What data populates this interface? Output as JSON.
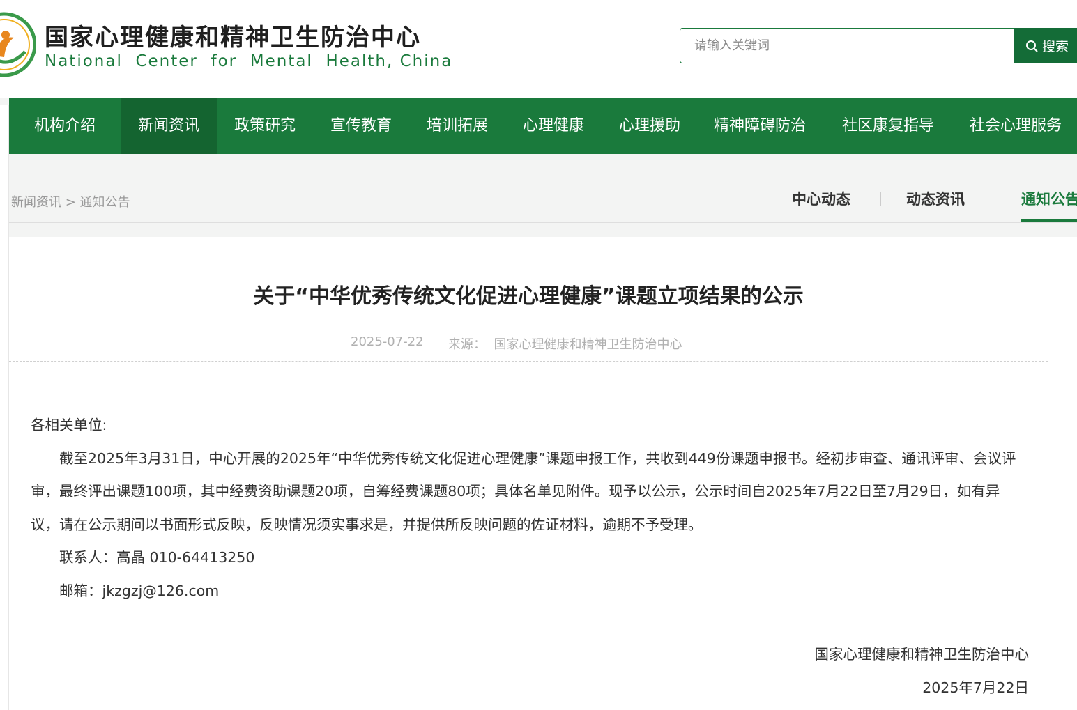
{
  "header": {
    "org_name_cn": "国家心理健康和精神卫生防治中心",
    "org_name_en": "National  Center  for  Mental  Health, China",
    "search": {
      "placeholder": "请输入关键词",
      "button_label": "搜索"
    }
  },
  "nav": {
    "items": [
      {
        "label": "机构介绍",
        "active": false
      },
      {
        "label": "新闻资讯",
        "active": true
      },
      {
        "label": "政策研究",
        "active": false
      },
      {
        "label": "宣传教育",
        "active": false
      },
      {
        "label": "培训拓展",
        "active": false
      },
      {
        "label": "心理健康",
        "active": false
      },
      {
        "label": "心理援助",
        "active": false
      },
      {
        "label": "精神障碍防治",
        "active": false
      },
      {
        "label": "社区康复指导",
        "active": false
      },
      {
        "label": "社会心理服务",
        "active": false
      }
    ]
  },
  "breadcrumb": {
    "parent": "新闻资讯",
    "separator": " > ",
    "current": "通知公告"
  },
  "subnav": {
    "tabs": [
      {
        "label": "中心动态",
        "active": false
      },
      {
        "label": "动态资讯",
        "active": false
      },
      {
        "label": "通知公告",
        "active": true
      }
    ]
  },
  "article": {
    "title": "关于“中华优秀传统文化促进心理健康”课题立项结果的公示",
    "date": "2025-07-22",
    "source": "来源：  国家心理健康和精神卫生防治中心",
    "salutation": "各相关单位:",
    "paragraph": "截至2025年3月31日，中心开展的2025年“中华优秀传统文化促进心理健康”课题申报工作，共收到449份课题申报书。经初步审查、通讯评审、会议评审，最终评出课题100项，其中经费资助课题20项，自筹经费课题80项；具体名单见附件。现予以公示，公示时间自2025年7月22日至7月29日，如有异议，请在公示期间以书面形式反映，反映情况须实事求是，并提供所反映问题的佐证材料，逾期不予受理。",
    "contact": "联系人：高晶 010-64413250",
    "email": "邮箱：jkzgzj@126.com",
    "signature_org": "国家心理健康和精神卫生防治中心",
    "signature_date": "2025年7月22日"
  },
  "colors": {
    "brand_green": "#1a7a3c",
    "nav_active": "#146430",
    "accent_orange": "#e8871e"
  }
}
